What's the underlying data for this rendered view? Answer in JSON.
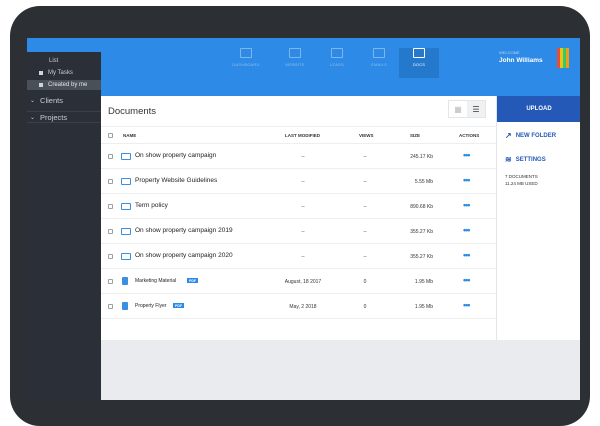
{
  "sidebar": {
    "list_label": "List",
    "my_tasks": "My Tasks",
    "created_by_me": "Created by me",
    "clients": "Clients",
    "projects": "Projects"
  },
  "nav": {
    "tabs": [
      {
        "label": "DASHBOARD"
      },
      {
        "label": "WEBSITE"
      },
      {
        "label": "LEADS"
      },
      {
        "label": "EMAILS"
      },
      {
        "label": "DOCS"
      }
    ],
    "welcome": "WELCOME",
    "user_name": "John Williams"
  },
  "documents": {
    "title": "Documents",
    "columns": {
      "name": "NAME",
      "last_modified": "LAST MODIFIED",
      "views": "VIEWS",
      "size": "SIZE",
      "actions": "ACTIONS"
    },
    "rows": [
      {
        "name": "On show property campaign",
        "modified": "--",
        "views": "--",
        "size": "245.17 Kb",
        "type": "folder"
      },
      {
        "name": "Property Website Guidelines",
        "modified": "--",
        "views": "--",
        "size": "5.55 Mb",
        "type": "folder"
      },
      {
        "name": "Term policy",
        "modified": "--",
        "views": "--",
        "size": "890.68 Kb",
        "type": "folder"
      },
      {
        "name": "On show property campaign 2019",
        "modified": "--",
        "views": "--",
        "size": "355.27 Kb",
        "type": "folder"
      },
      {
        "name": "On show property campaign 2020",
        "modified": "--",
        "views": "--",
        "size": "355.27 Kb",
        "type": "folder"
      },
      {
        "name": "Marketing Material",
        "badge": "PDF",
        "modified": "August, 18 2017",
        "views": "0",
        "size": "1.95 Mb",
        "type": "file"
      },
      {
        "name": "Property Flyer",
        "badge": "PDF",
        "modified": "May, 2 2018",
        "views": "0",
        "size": "1.95 Mb",
        "type": "file"
      }
    ],
    "actions_glyph": "•••"
  },
  "right_panel": {
    "upload": "UPLOAD",
    "new_folder": "NEW FOLDER",
    "settings": "SETTINGS",
    "doc_count": "7 DOCUMENTS",
    "used": "11.24 MB USED"
  },
  "colors": {
    "accent": "#2d8ae6",
    "upload": "#2459b8",
    "sidebar": "#2b3038"
  },
  "avatar_colors": [
    "#e84c3d",
    "#f1c40f",
    "#2ecc71",
    "#f39c12"
  ]
}
